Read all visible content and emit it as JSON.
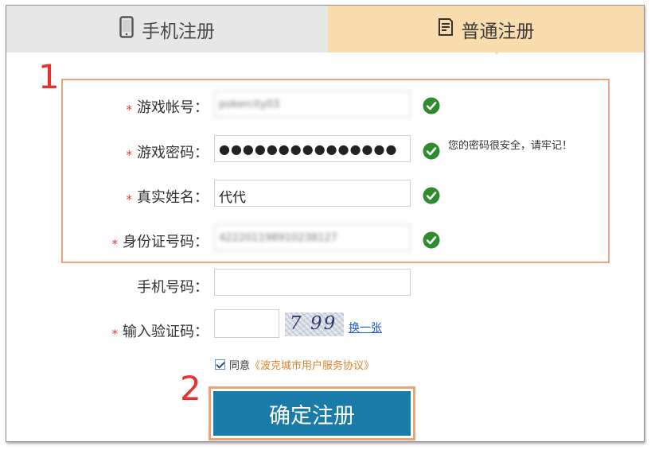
{
  "tabs": {
    "phone": {
      "label": "手机注册",
      "icon": "mobile-phone-icon"
    },
    "normal": {
      "label": "普通注册",
      "icon": "document-icon"
    }
  },
  "annotations": {
    "one": "1",
    "two": "2"
  },
  "required_mark": "*",
  "form": {
    "game_account": {
      "label": "游戏帐号：",
      "value": "pokercity03"
    },
    "game_password": {
      "label": "游戏密码：",
      "value": "●●●●●●●●●●●●●●●",
      "hint": "您的密码很安全，请牢记！"
    },
    "real_name": {
      "label": "真实姓名：",
      "value": "代代"
    },
    "id_number": {
      "label": "身份证号码：",
      "value": "422201198910238127"
    },
    "phone": {
      "label": "手机号码：",
      "value": ""
    },
    "captcha": {
      "label": "输入验证码：",
      "value": "",
      "image_text": "7 99",
      "refresh_label": "换一张"
    }
  },
  "agreement": {
    "prefix": "同意",
    "link": "《波克城市用户服务协议》",
    "checked": true
  },
  "submit_label": "确定注册",
  "colors": {
    "accent_blue": "#1a7ba9",
    "tab_active": "#f8dcae",
    "tab_inactive": "#e7e7e7",
    "highlight": "#f0a27a",
    "required": "#e8322f",
    "success_green": "#2e8b2e",
    "link_orange": "#e0832a"
  }
}
